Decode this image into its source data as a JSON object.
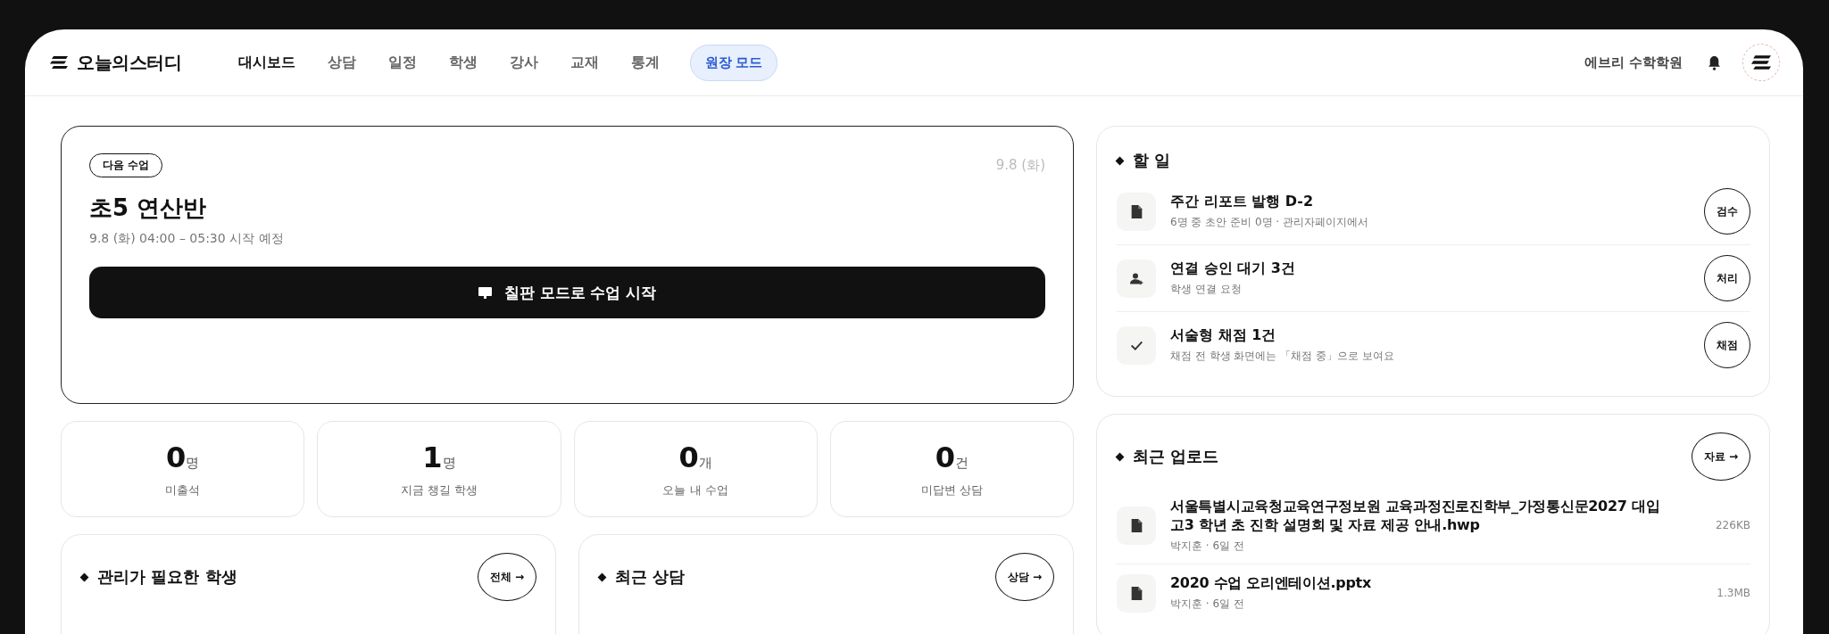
{
  "header": {
    "logo": "오늘의스터디",
    "nav": [
      {
        "label": "대시보드",
        "selected": true
      },
      {
        "label": "상담",
        "selected": false
      },
      {
        "label": "일정",
        "selected": false
      },
      {
        "label": "학생",
        "selected": false
      },
      {
        "label": "강사",
        "selected": false
      },
      {
        "label": "교재",
        "selected": false
      },
      {
        "label": "통계",
        "selected": false
      }
    ],
    "mode_button": "원장 모드",
    "academy": "에브리 수학학원"
  },
  "next_class": {
    "badge": "다음 수업",
    "date": "9.8 (화)",
    "title": "초5 연산반",
    "time": "9.8 (화) 04:00 – 05:30 시작 예정",
    "start_button": "칠판 모드로 수업 시작"
  },
  "stats": [
    {
      "value": "0",
      "unit": "명",
      "label": "미출석"
    },
    {
      "value": "1",
      "unit": "명",
      "label": "지금 챙길 학생"
    },
    {
      "value": "0",
      "unit": "개",
      "label": "오늘 내 수업"
    },
    {
      "value": "0",
      "unit": "건",
      "label": "미답변 상담"
    }
  ],
  "students_card": {
    "title": "관리가 필요한 학생",
    "button": "전체 →"
  },
  "consult_card": {
    "title": "최근 상담",
    "button": "상담 →"
  },
  "todo": {
    "title": "할 일",
    "items": [
      {
        "kind": "document",
        "title": "주간 리포트 발행 D-2",
        "subtitle": "6명 중 초안 준비 0명 · 관리자페이지에서",
        "button": "검수"
      },
      {
        "kind": "person",
        "title": "연결 승인 대기 3건",
        "subtitle": "학생 연결 요청",
        "button": "처리"
      },
      {
        "kind": "check",
        "title": "서술형 채점 1건",
        "subtitle": "채점 전 학생 화면에는 「채점 중」으로 보여요",
        "button": "채점"
      }
    ]
  },
  "uploads": {
    "title": "최근 업로드",
    "button": "자료 →",
    "items": [
      {
        "name": "서울특별시교육청교육연구정보원 교육과정진로진학부_가정통신문2027 대입 고3 학년 초 진학 설명회 및 자료 제공 안내.hwp",
        "meta": "박지훈 · 6일 전",
        "size": "226KB"
      },
      {
        "name": "2020 수업 오리엔테이션.pptx",
        "meta": "박지훈 · 6일 전",
        "size": "1.3MB"
      }
    ]
  }
}
